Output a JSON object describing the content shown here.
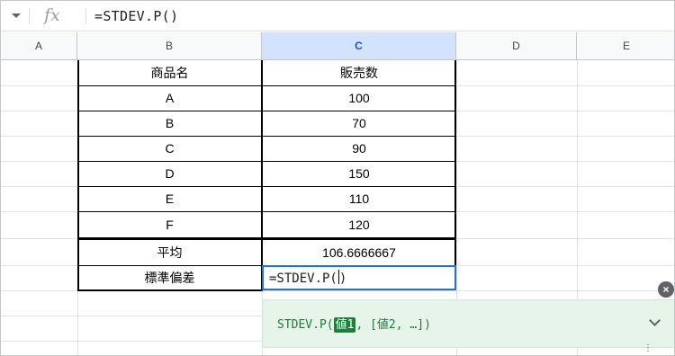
{
  "formula_bar": {
    "fx_label": "fx",
    "formula": "=STDEV.P()"
  },
  "columns": [
    "A",
    "B",
    "C",
    "D",
    "E"
  ],
  "table": {
    "header": {
      "item": "商品名",
      "sales": "販売数"
    },
    "rows": [
      {
        "item": "A",
        "sales": "100"
      },
      {
        "item": "B",
        "sales": "70"
      },
      {
        "item": "C",
        "sales": "90"
      },
      {
        "item": "D",
        "sales": "150"
      },
      {
        "item": "E",
        "sales": "110"
      },
      {
        "item": "F",
        "sales": "120"
      }
    ],
    "average_label": "平均",
    "average_value": "106.6666667",
    "stdev_label": "標準偏差",
    "stdev_input": "=STDEV.P("
  },
  "tooltip": {
    "func": "STDEV.P(",
    "arg1": "値1",
    "rest": ", [値2, …])"
  },
  "icons": {
    "dropdown": "chevron-down-icon",
    "close": "close-icon",
    "expand": "chevron-down-icon",
    "more": "more-vert-icon"
  }
}
